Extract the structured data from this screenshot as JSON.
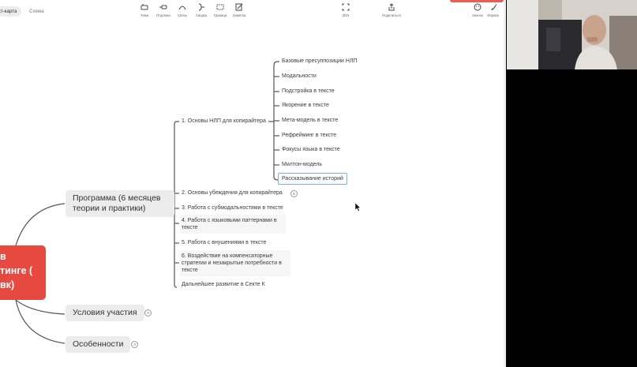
{
  "topbar": {
    "mode_tabs": [
      "кт-карта",
      "Схема"
    ],
    "tools": [
      "Тема",
      "Подтема",
      "Связь",
      "Сводка",
      "Граница",
      "Заметка",
      "ZEN",
      "Поделиться",
      "Значок",
      "Формат"
    ]
  },
  "map": {
    "root": "в\nтинге (\nвк)",
    "branches": [
      "Программа (6 месяцев теории и практики)",
      "Условия участия",
      "Особенности"
    ],
    "program_children": [
      "1. Основы НЛП для копирайтера",
      "2. Основы убеждения для копирайтера",
      "3. Работа с субмодальностями в тексте",
      "4. Работа с языковыми паттернами в тексте",
      "5. Работа с внушениями в тексте",
      "6. Воздействие на компенсаторные стратегии и незакрытые потребности в тексте",
      "Дальнейшее развитие в Секте К"
    ],
    "nlp_children": [
      "Базовые пресуппозиции НЛП",
      "Модальности",
      "Подстройка в тексте",
      "Якорение в тексте",
      "Мета-модель в тексте",
      "Рефрейминг в тексте",
      "Фокусы языка в тексте",
      "Милтон-модель",
      "Рассказывание историй"
    ],
    "collapse_counts": [
      "6",
      "3",
      "3"
    ]
  }
}
